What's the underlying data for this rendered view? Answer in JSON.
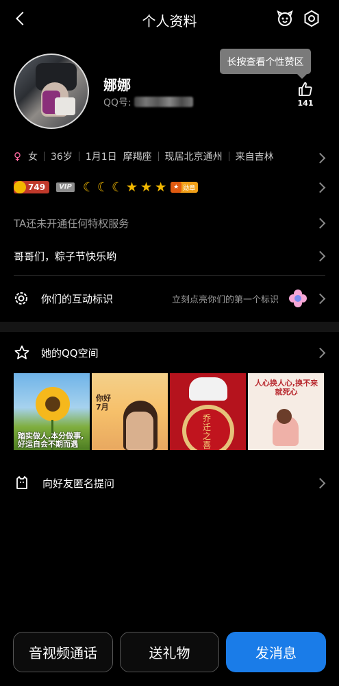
{
  "header": {
    "title": "个人资料"
  },
  "tooltip": {
    "text": "长按查看个性赞区"
  },
  "profile": {
    "name": "娜娜",
    "qq_label": "QQ号:",
    "likes": "141"
  },
  "info": {
    "gender": "女",
    "age": "36岁",
    "birthday": "1月1日",
    "zodiac": "摩羯座",
    "location": "现居北京通州",
    "hometown": "来自吉林"
  },
  "badges": {
    "level": "749",
    "vip": "VIP",
    "medal": "勋章"
  },
  "privilege": {
    "text": "TA还未开通任何特权服务"
  },
  "signature": {
    "text": "哥哥们，粽子节快乐哟"
  },
  "interaction": {
    "label": "你们的互动标识",
    "hint": "立刻点亮你们的第一个标识"
  },
  "qzone": {
    "label": "她的QQ空间",
    "thumbs": [
      {
        "caption": "踏实做人,本分做事,好运自会不期而遇"
      },
      {
        "caption": "你好 7月"
      },
      {
        "caption": "乔迁之喜"
      },
      {
        "caption": "人心换人心,换不来就死心"
      }
    ]
  },
  "anon": {
    "label": "向好友匿名提问"
  },
  "actions": {
    "call": "音视频通话",
    "gift": "送礼物",
    "message": "发消息"
  },
  "colors": {
    "accent": "#1a7ce8",
    "gold": "#f2b800",
    "gender": "#ff6aa0"
  }
}
